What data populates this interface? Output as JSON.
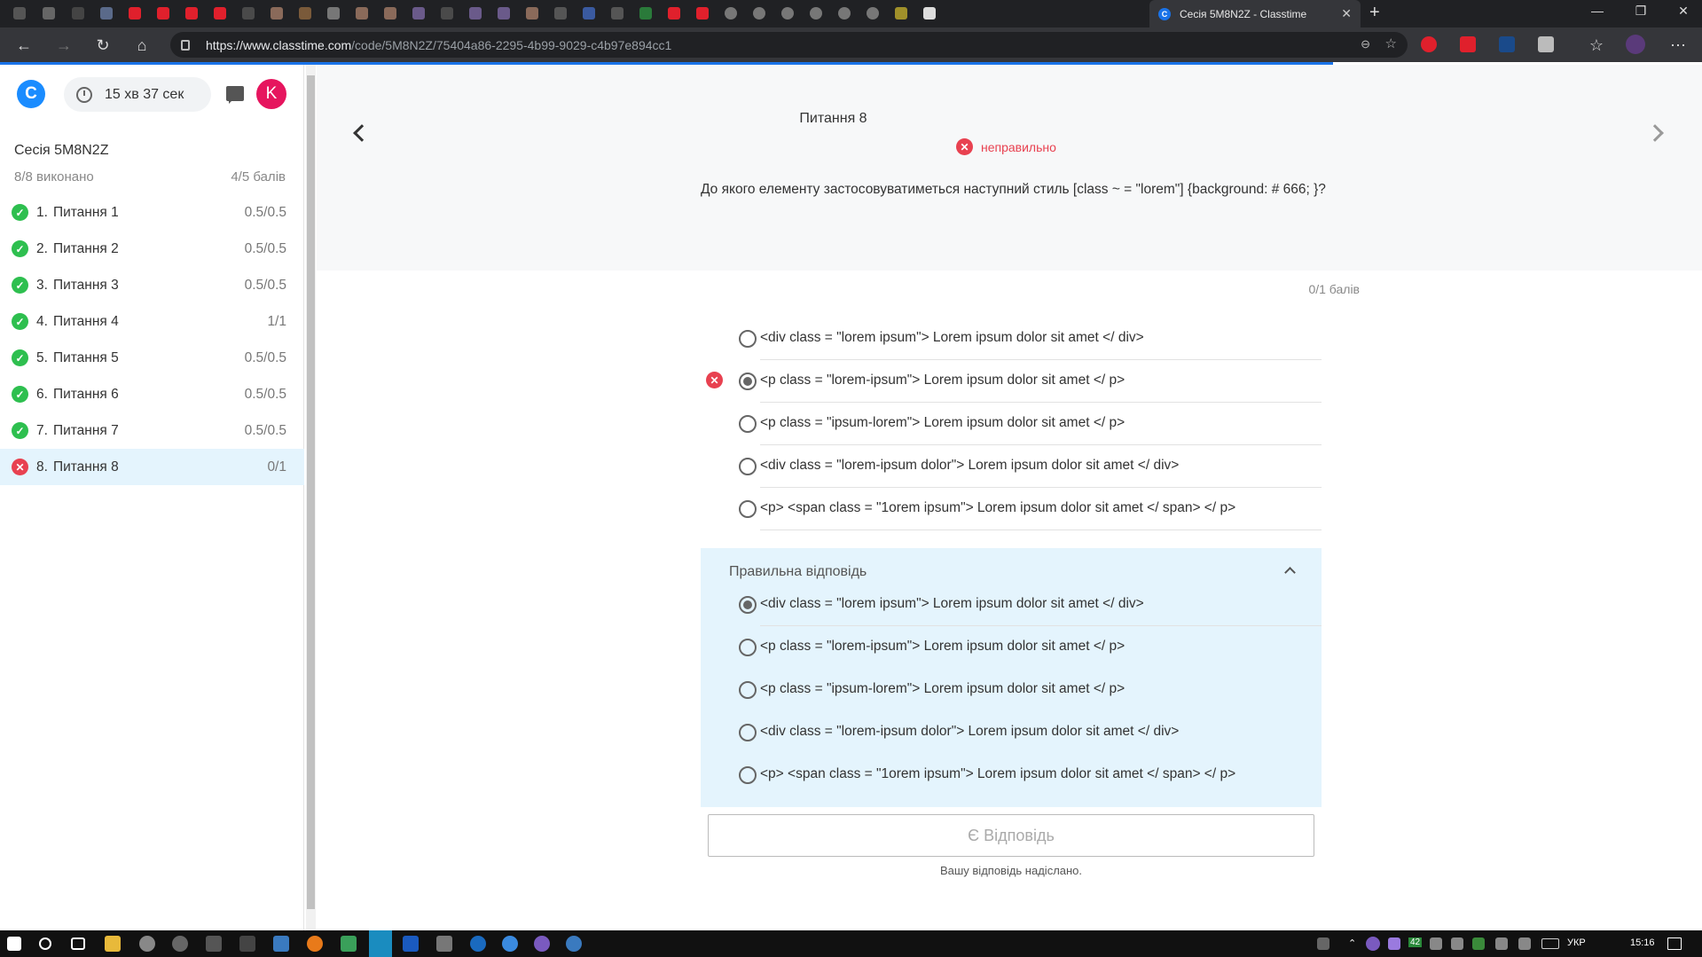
{
  "browser": {
    "active_tab_title": "Сесія 5M8N2Z - Classtime",
    "active_tab_favicon": "C",
    "url_domain": "https://www.classtime.com",
    "url_path": "/code/5M8N2Z/75404a86-2295-4b99-9029-c4b97e894cc1",
    "accent_color": "#1a73e8"
  },
  "sidebar": {
    "logo": "C",
    "timer": "15 хв 37 сек",
    "avatar_initial": "K",
    "session_title": "Сесія 5M8N2Z",
    "progress": "8/8 виконано",
    "score": "4/5 балів",
    "questions": [
      {
        "num": "1.",
        "label": "Питання 1",
        "score": "0.5/0.5",
        "status": "correct"
      },
      {
        "num": "2.",
        "label": "Питання 2",
        "score": "0.5/0.5",
        "status": "correct"
      },
      {
        "num": "3.",
        "label": "Питання 3",
        "score": "0.5/0.5",
        "status": "correct"
      },
      {
        "num": "4.",
        "label": "Питання 4",
        "score": "1/1",
        "status": "correct"
      },
      {
        "num": "5.",
        "label": "Питання 5",
        "score": "0.5/0.5",
        "status": "correct"
      },
      {
        "num": "6.",
        "label": "Питання 6",
        "score": "0.5/0.5",
        "status": "correct"
      },
      {
        "num": "7.",
        "label": "Питання 7",
        "score": "0.5/0.5",
        "status": "correct"
      },
      {
        "num": "8.",
        "label": "Питання 8",
        "score": "0/1",
        "status": "incorrect"
      }
    ]
  },
  "question": {
    "title": "Питання 8",
    "status_text": "неправильно",
    "text": "До якого елементу застосовуватиметься наступний стиль [class ~ = \"lorem\"] {background: # 666; }?",
    "points": "0/1 балів",
    "options": [
      "<div class = \"lorem ipsum\"> Lorem ipsum dolor sit amet </ div>",
      "<p class = \"lorem-ipsum\"> Lorem ipsum dolor sit amet </ p>",
      "<p class = \"ipsum-lorem\"> Lorem ipsum dolor sit amet </ p>",
      "<div class = \"lorem-ipsum dolor\"> Lorem ipsum dolor sit amet </ div>",
      "<p> <span class = \"1orem ipsum\"> Lorem ipsum dolor sit amet </ span> </ p>"
    ],
    "selected_index": 1,
    "correct_title": "Правильна відповідь",
    "correct_index": 0,
    "answer_button": "Є Відповідь",
    "submitted_text": "Вашу відповідь надіслано."
  },
  "taskbar": {
    "lang": "УКР",
    "time": "15:16",
    "badge": "42"
  },
  "colors": {
    "correct": "#2ebf4f",
    "incorrect": "#e84150",
    "highlight": "#e4f4fd"
  }
}
